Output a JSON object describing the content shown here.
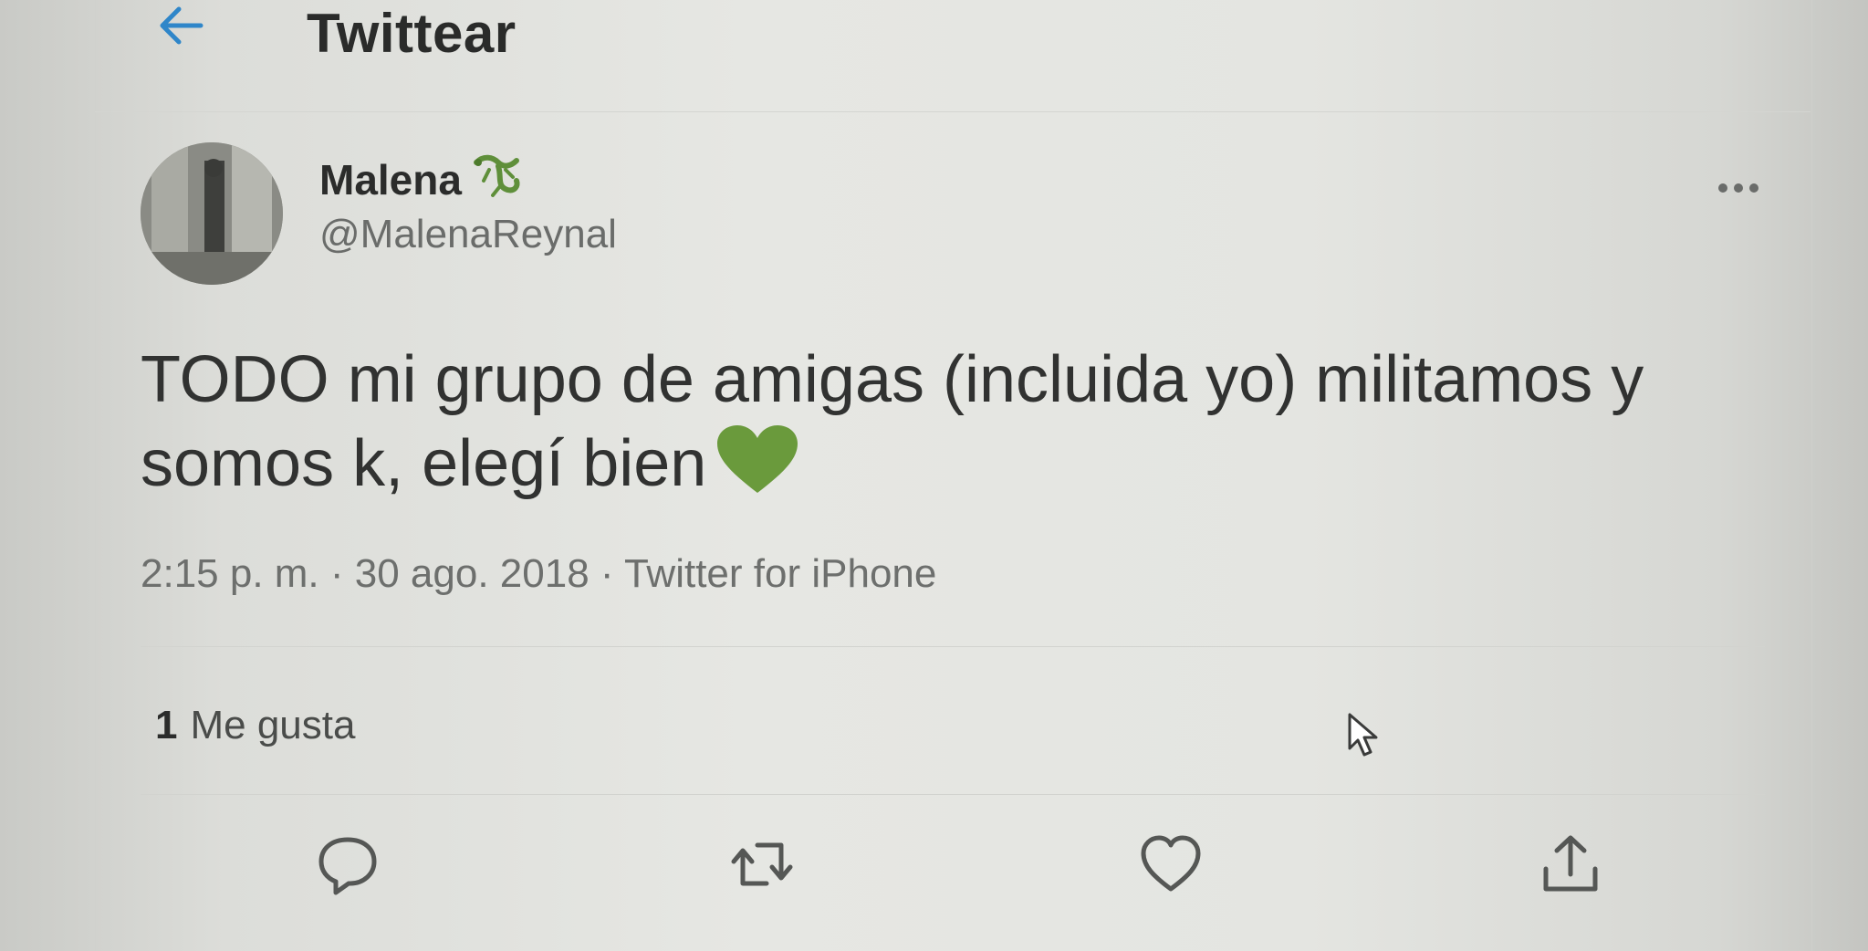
{
  "header": {
    "title": "Twittear",
    "back_icon": "arrow-left-icon"
  },
  "tweet": {
    "display_name": "Malena",
    "name_emoji": "lizard-emoji",
    "handle": "@MalenaReynal",
    "text_line_1": "TODO mi grupo de amigas (incluida yo) militamos y",
    "text_line_2": "somos k, elegí bien",
    "text_emoji": "green-heart-emoji",
    "meta": "2:15 p. m. · 30 ago. 2018 · Twitter for iPhone",
    "likes_count": "1",
    "likes_label": "Me gusta"
  },
  "actions": [
    "reply-icon",
    "retweet-icon",
    "like-icon",
    "share-icon"
  ],
  "colors": {
    "accent": "#1d9bf0",
    "heart_green": "#6a9a3c",
    "text": "#313231",
    "secondary_text": "#6d6f6d",
    "icon": "#555755"
  }
}
